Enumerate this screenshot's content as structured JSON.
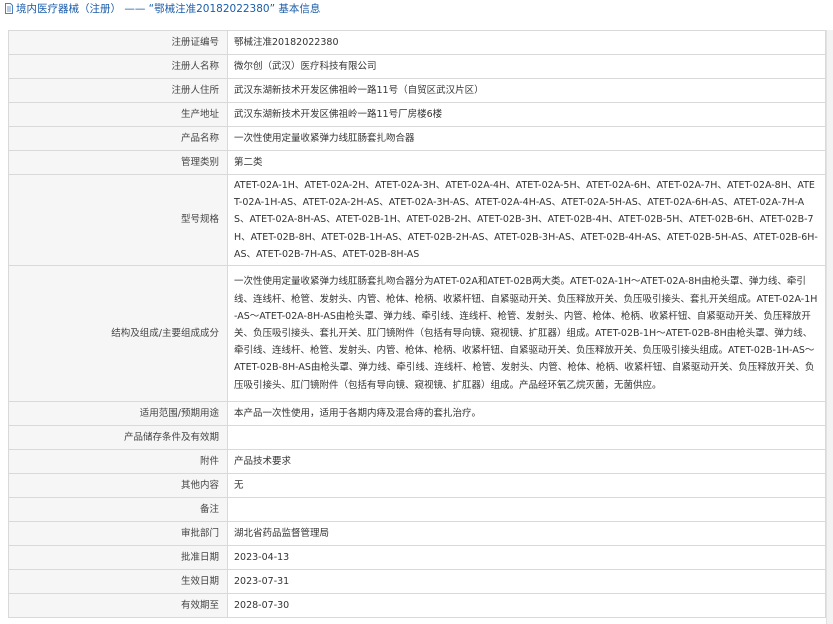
{
  "header": {
    "title": "境内医疗器械（注册） —— “鄂械注准20182022380” 基本信息",
    "icon": "document-icon"
  },
  "rows": [
    {
      "label": "注册证编号",
      "value": "鄂械注准20182022380"
    },
    {
      "label": "注册人名称",
      "value": "微尔创（武汉）医疗科技有限公司"
    },
    {
      "label": "注册人住所",
      "value": "武汉东湖新技术开发区佛祖岭一路11号（自贸区武汉片区）"
    },
    {
      "label": "生产地址",
      "value": "武汉东湖新技术开发区佛祖岭一路11号厂房楼6楼"
    },
    {
      "label": "产品名称",
      "value": "一次性使用定量收紧弹力线肛肠套扎吻合器"
    },
    {
      "label": "管理类别",
      "value": "第二类"
    },
    {
      "label": "型号规格",
      "value": "ATET-02A-1H、ATET-02A-2H、ATET-02A-3H、ATET-02A-4H、ATET-02A-5H、ATET-02A-6H、ATET-02A-7H、ATET-02A-8H、ATET-02A-1H-AS、ATET-02A-2H-AS、ATET-02A-3H-AS、ATET-02A-4H-AS、ATET-02A-5H-AS、ATET-02A-6H-AS、ATET-02A-7H-AS、ATET-02A-8H-AS、ATET-02B-1H、ATET-02B-2H、ATET-02B-3H、ATET-02B-4H、ATET-02B-5H、ATET-02B-6H、ATET-02B-7H、ATET-02B-8H、ATET-02B-1H-AS、ATET-02B-2H-AS、ATET-02B-3H-AS、ATET-02B-4H-AS、ATET-02B-5H-AS、ATET-02B-6H-AS、ATET-02B-7H-AS、ATET-02B-8H-AS"
    },
    {
      "label": "结构及组成/主要组成成分",
      "value": "一次性使用定量收紧弹力线肛肠套扎吻合器分为ATET-02A和ATET-02B两大类。ATET-02A-1H～ATET-02A-8H由枪头罩、弹力线、牵引线、连线杆、枪管、发射头、内管、枪体、枪柄、收紧杆钮、自紧驱动开关、负压释放开关、负压吸引接头、套扎开关组成。ATET-02A-1H-AS～ATET-02A-8H-AS由枪头罩、弹力线、牵引线、连线杆、枪管、发射头、内管、枪体、枪柄、收紧杆钮、自紧驱动开关、负压释放开关、负压吸引接头、套扎开关、肛门镜附件（包括有导向镜、窥视镜、扩肛器）组成。ATET-02B-1H～ATET-02B-8H由枪头罩、弹力线、牵引线、连线杆、枪管、发射头、内管、枪体、枪柄、收紧杆钮、自紧驱动开关、负压释放开关、负压吸引接头组成。ATET-02B-1H-AS～ATET-02B-8H-AS由枪头罩、弹力线、牵引线、连线杆、枪管、发射头、内管、枪体、枪柄、收紧杆钮、自紧驱动开关、负压释放开关、负压吸引接头、肛门镜附件（包括有导向镜、窥视镜、扩肛器）组成。产品经环氧乙烷灭菌，无菌供应。"
    },
    {
      "label": "适用范围/预期用途",
      "value": "本产品一次性使用，适用于各期内痔及混合痔的套扎治疗。"
    },
    {
      "label": "产品储存条件及有效期",
      "value": ""
    },
    {
      "label": "附件",
      "value": "产品技术要求"
    },
    {
      "label": "其他内容",
      "value": "无"
    },
    {
      "label": "备注",
      "value": ""
    },
    {
      "label": "审批部门",
      "value": "湖北省药品监督管理局"
    },
    {
      "label": "批准日期",
      "value": "2023-04-13"
    },
    {
      "label": "生效日期",
      "value": "2023-07-31"
    },
    {
      "label": "有效期至",
      "value": "2028-07-30"
    }
  ]
}
